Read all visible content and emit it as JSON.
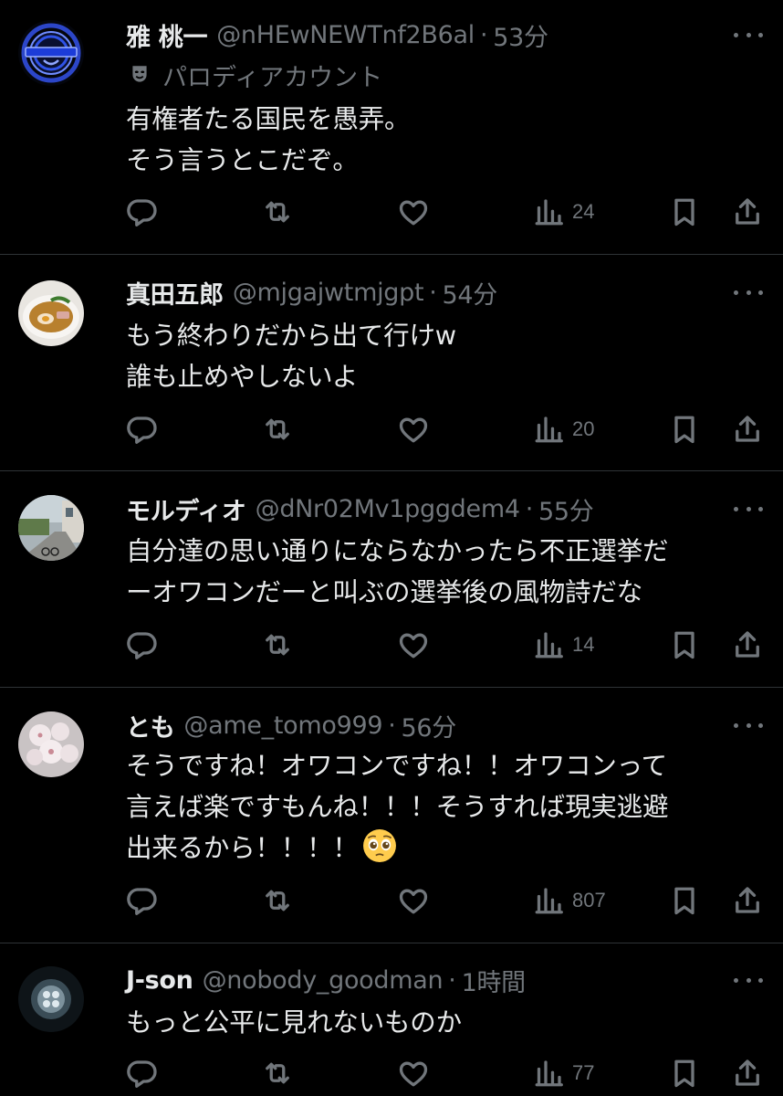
{
  "feed": {
    "posts": [
      {
        "display_name": "雅 桃一",
        "handle": "@nHEwNEWTnf2B6al",
        "separator": "·",
        "time": "53分",
        "badge": "パロディアカウント",
        "badge_icon": "theater-mask-icon",
        "text": "有権者たる国民を愚弄。\nそう言うとこだぞ。",
        "views": "24",
        "avatar_icon": "laughing-man-logo"
      },
      {
        "display_name": "真田五郎",
        "handle": "@mjgajwtmjgpt",
        "separator": "·",
        "time": "54分",
        "text": "もう終わりだから出て行けw\n誰も止めやしないよ",
        "views": "20",
        "avatar_icon": "ramen-bowl-photo"
      },
      {
        "display_name": "モルディオ",
        "handle": "@dNr02Mv1pggdem4",
        "separator": "·",
        "time": "55分",
        "text": "自分達の思い通りにならなかったら不正選挙だ\nーオワコンだーと叫ぶの選挙後の風物詩だな",
        "views": "14",
        "avatar_icon": "street-photo"
      },
      {
        "display_name": "とも",
        "handle": "@ame_tomo999",
        "separator": "·",
        "time": "56分",
        "text": "そうですね！オワコンですね！！オワコンって\n言えば楽ですもんね！！！そうすれば現実逃避\n出来るから！！！！",
        "emoji": "pleading-face-emoji",
        "views": "807",
        "avatar_icon": "cherry-blossom-photo"
      },
      {
        "display_name": "J-son",
        "handle": "@nobody_goodman",
        "separator": "·",
        "time": "1時間",
        "text": "もっと公平に見れないものか",
        "views": "77",
        "avatar_icon": "jellyfish-photo"
      }
    ]
  },
  "colors": {
    "background": "#000000",
    "primary_text": "#e7e9ea",
    "secondary_text": "#71767b",
    "divider": "#2f3336"
  }
}
